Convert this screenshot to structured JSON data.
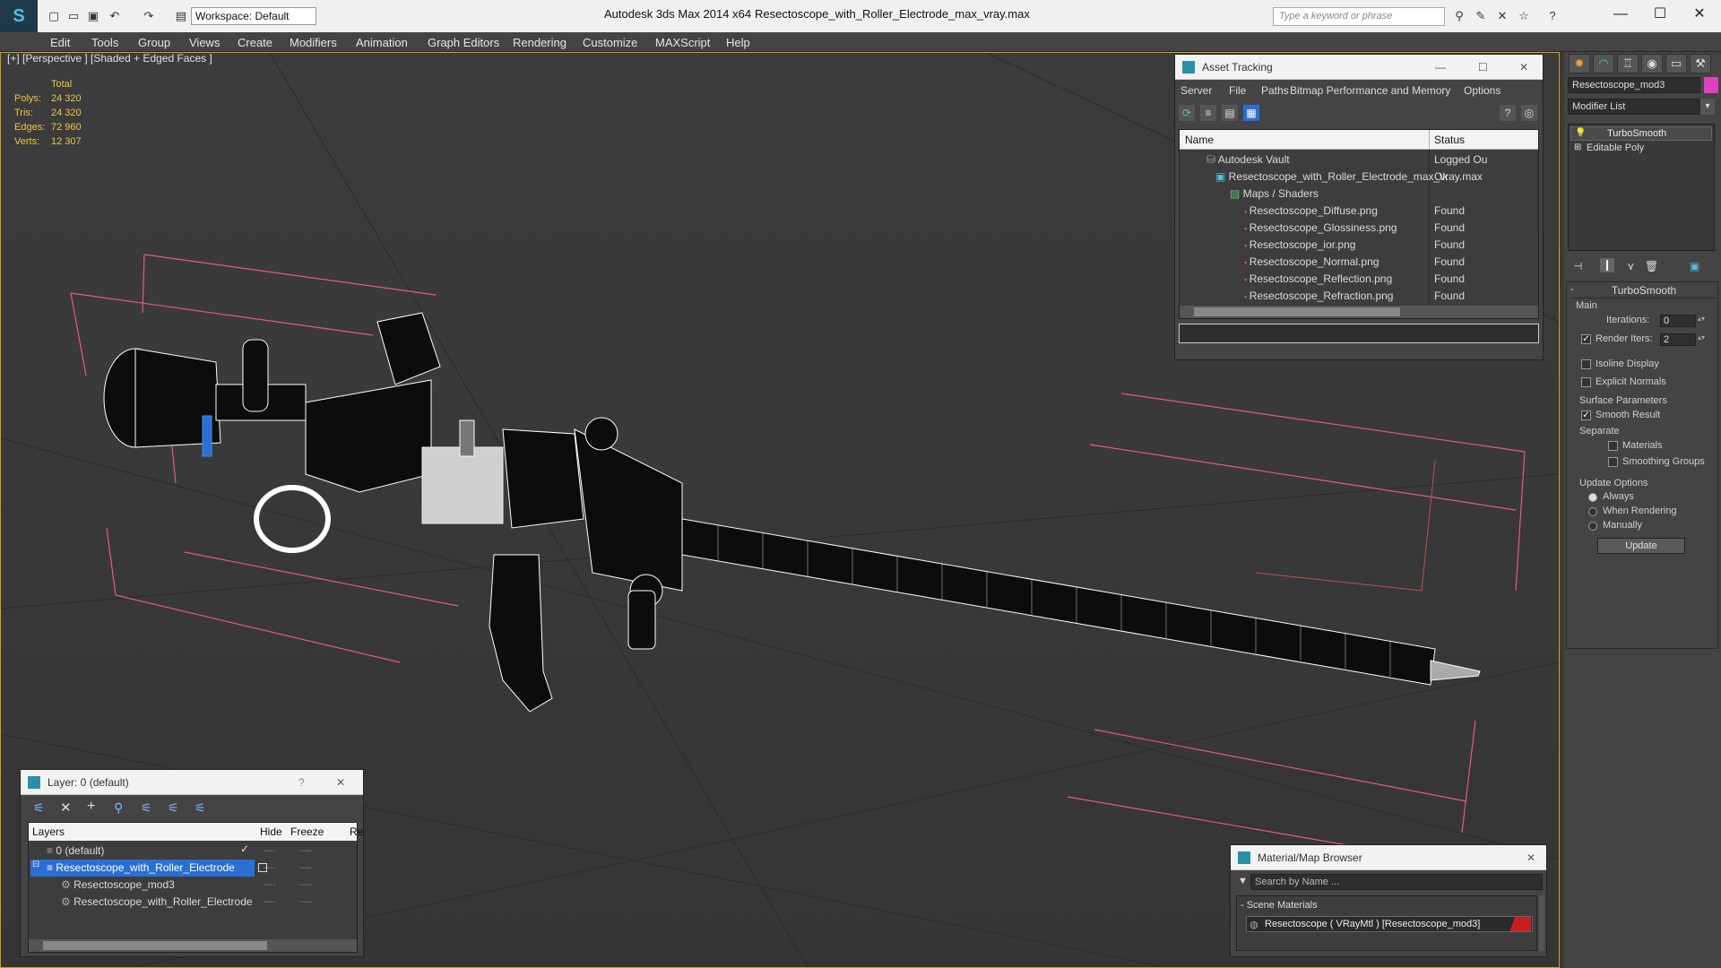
{
  "app": {
    "title": "Autodesk 3ds Max  2014 x64",
    "file": "Resectoscope_with_Roller_Electrode_max_vray.max",
    "workspace": "Workspace: Default",
    "search_placeholder": "Type a keyword or phrase"
  },
  "menu": [
    "Edit",
    "Tools",
    "Group",
    "Views",
    "Create",
    "Modifiers",
    "Animation",
    "Graph Editors",
    "Rendering",
    "Customize",
    "MAXScript",
    "Help"
  ],
  "viewport": {
    "label": "[+] [Perspective ] [Shaded + Edged Faces ]",
    "stats_header": "Total",
    "stats": [
      {
        "label": "Polys:",
        "value": "24 320"
      },
      {
        "label": "Tris:",
        "value": "24 320"
      },
      {
        "label": "Edges:",
        "value": "72 960"
      },
      {
        "label": "Verts:",
        "value": "12 307"
      }
    ]
  },
  "asset_tracking": {
    "title": "Asset Tracking",
    "menu": [
      "Server",
      "File",
      "Paths",
      "Bitmap Performance and Memory",
      "Options"
    ],
    "col_name": "Name",
    "col_status": "Status",
    "rows": [
      {
        "name": "Autodesk Vault",
        "status": "Logged Ou"
      },
      {
        "name": "Resectoscope_with_Roller_Electrode_max_vray.max",
        "status": "Ok"
      },
      {
        "name": "Maps / Shaders",
        "status": ""
      },
      {
        "name": "Resectoscope_Diffuse.png",
        "status": "Found"
      },
      {
        "name": "Resectoscope_Glossiness.png",
        "status": "Found"
      },
      {
        "name": "Resectoscope_ior.png",
        "status": "Found"
      },
      {
        "name": "Resectoscope_Normal.png",
        "status": "Found"
      },
      {
        "name": "Resectoscope_Reflection.png",
        "status": "Found"
      },
      {
        "name": "Resectoscope_Refraction.png",
        "status": "Found"
      }
    ]
  },
  "layers": {
    "title": "Layer: 0 (default)",
    "help": "?",
    "col_layers": "Layers",
    "col_hide": "Hide",
    "col_freeze": "Freeze",
    "col_render": "Re",
    "rows": [
      {
        "name": "0 (default)"
      },
      {
        "name": "Resectoscope_with_Roller_Electrode"
      },
      {
        "name": "Resectoscope_mod3"
      },
      {
        "name": "Resectoscope_with_Roller_Electrode"
      }
    ],
    "dash": "----"
  },
  "material_browser": {
    "title": "Material/Map Browser",
    "search_placeholder": "Search by Name ...",
    "group": "- Scene Materials",
    "item": "Resectoscope  ( VRayMtl )  [Resectoscope_mod3]"
  },
  "command_panel": {
    "object_name": "Resectoscope_mod3",
    "object_color": "#e040c0",
    "modifier_list": "Modifier List",
    "stack": [
      "TurboSmooth",
      "Editable Poly"
    ],
    "rollout": "TurboSmooth",
    "main": "Main",
    "iterations_label": "Iterations:",
    "iterations": "0",
    "render_iters_label": "Render Iters:",
    "render_iters": "2",
    "isoline": "Isoline Display",
    "explicit_normals": "Explicit Normals",
    "surface_params": "Surface Parameters",
    "smooth_result": "Smooth Result",
    "separate": "Separate",
    "materials": "Materials",
    "smoothing_groups": "Smoothing Groups",
    "update_options": "Update Options",
    "always": "Always",
    "when_rendering": "When Rendering",
    "manually": "Manually",
    "update_button": "Update"
  },
  "colors": {
    "accent": "#c9a227",
    "selection": "#2a6fd4",
    "bbox": "#e05a8a"
  }
}
